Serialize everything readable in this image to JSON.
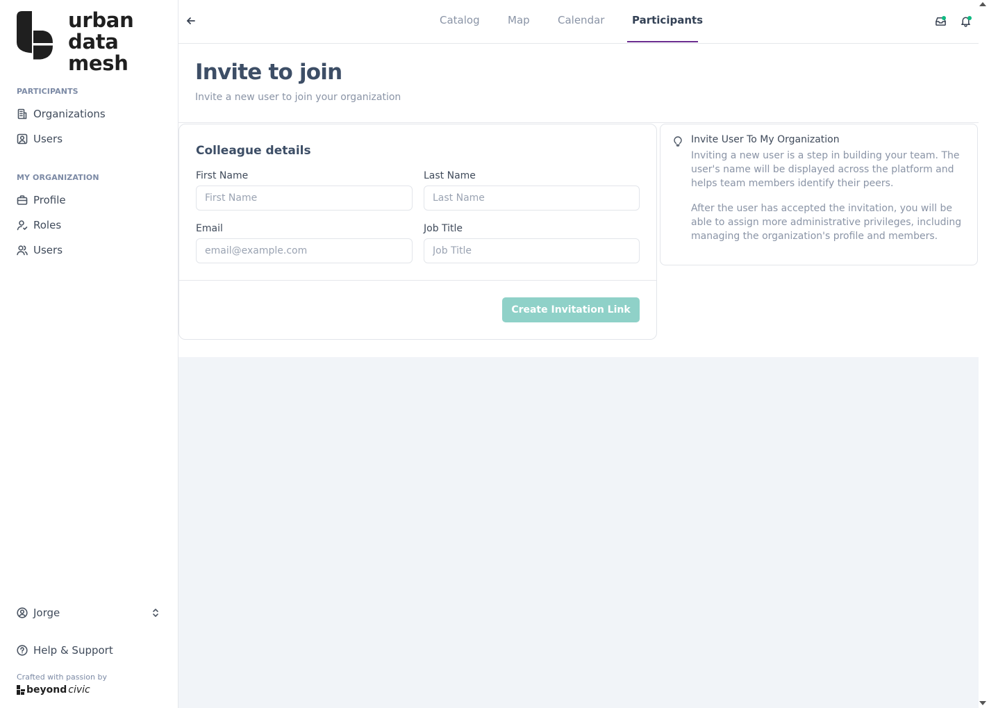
{
  "brand": {
    "lines": [
      "urban",
      "data",
      "mesh"
    ]
  },
  "sidebar": {
    "participants_label": "PARTICIPANTS",
    "participants_items": [
      {
        "label": "Organizations",
        "icon": "building-icon"
      },
      {
        "label": "Users",
        "icon": "user-square-icon"
      }
    ],
    "my_org_label": "MY ORGANIZATION",
    "my_org_items": [
      {
        "label": "Profile",
        "icon": "briefcase-icon"
      },
      {
        "label": "Roles",
        "icon": "user-icon"
      },
      {
        "label": "Users",
        "icon": "users-icon"
      }
    ],
    "user_name": "Jorge",
    "help_label": "Help & Support",
    "crafted": "Crafted with passion by",
    "beyond_bold": "beyond",
    "beyond_italic": "civic"
  },
  "topbar": {
    "tabs": [
      "Catalog",
      "Map",
      "Calendar",
      "Participants"
    ],
    "active_tab": "Participants",
    "accent": "#6b2c8f"
  },
  "page": {
    "title": "Invite to join",
    "subtitle": "Invite a new user to join your organization"
  },
  "form": {
    "title": "Colleague details",
    "first_name_label": "First Name",
    "first_name_placeholder": "First Name",
    "last_name_label": "Last Name",
    "last_name_placeholder": "Last Name",
    "email_label": "Email",
    "email_placeholder": "email@example.com",
    "job_title_label": "Job Title",
    "job_title_placeholder": "Job Title",
    "submit_label": "Create Invitation Link",
    "button_color": "#8fd1c8"
  },
  "info": {
    "title": "Invite User To My Organization",
    "p1": "Inviting a new user is a step in building your team. The user's name will be displayed across the platform and helps team members identify their peers.",
    "p2": "After the user has accepted the invitation, you will be able to assign more administrative privileges, including managing the organization's profile and members."
  }
}
